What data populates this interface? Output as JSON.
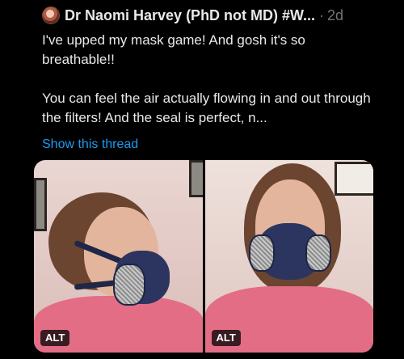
{
  "tweet": {
    "display_name": "Dr Naomi Harvey (PhD not MD) #W...",
    "separator": "·",
    "timestamp": "2d",
    "text_line1": "I've upped my mask game! And gosh it's so breathable!!",
    "text_line2": "You can feel the air actually flowing in and out through the filters! And the seal is perfect, n...",
    "show_thread_label": "Show this thread",
    "media": [
      {
        "alt_label": "ALT"
      },
      {
        "alt_label": "ALT"
      }
    ]
  },
  "colors": {
    "background": "#000000",
    "text": "#e7e9ea",
    "muted": "#71767b",
    "link": "#1d9bf0"
  }
}
